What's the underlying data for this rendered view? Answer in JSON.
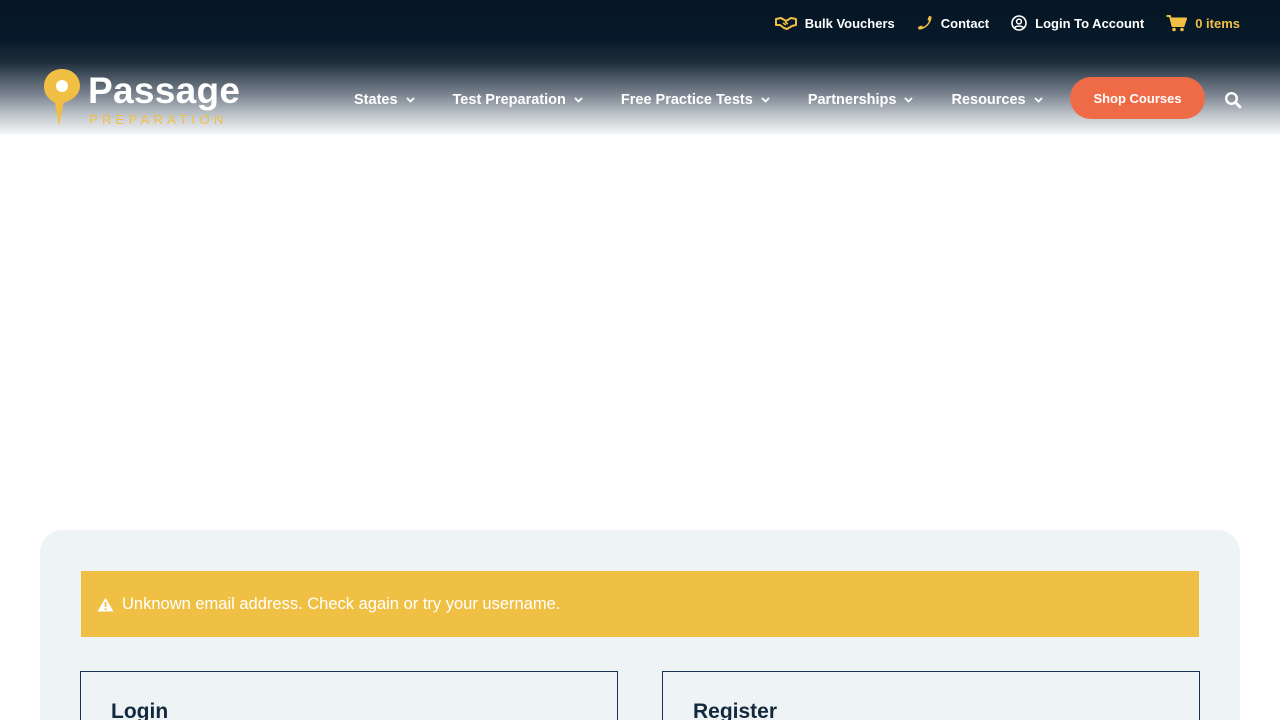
{
  "topbar": {
    "bulk_vouchers": "Bulk Vouchers",
    "contact": "Contact",
    "login": "Login To Account",
    "cart": "0 items"
  },
  "logo": {
    "word": "Passage",
    "sub": "PREPARATION"
  },
  "nav": {
    "items": [
      {
        "label": "States"
      },
      {
        "label": "Test Preparation"
      },
      {
        "label": "Free Practice Tests"
      },
      {
        "label": "Partnerships"
      },
      {
        "label": "Resources"
      }
    ],
    "shop_label": "Shop Courses"
  },
  "notice": {
    "message": "Unknown email address. Check again or try your username."
  },
  "forms": {
    "login_title": "Login",
    "register_title": "Register"
  },
  "colors": {
    "accent_yellow": "#f1bf44",
    "cta_orange": "#ef6b47",
    "navy": "#061523",
    "panel_bg": "#eef3f5"
  },
  "icons": {
    "bulk_vouchers": "handshake-icon",
    "contact": "phone-icon",
    "login": "user-circle-icon",
    "cart": "cart-icon",
    "search": "search-icon",
    "notice": "warning-icon",
    "nav_caret": "chevron-down-icon"
  }
}
